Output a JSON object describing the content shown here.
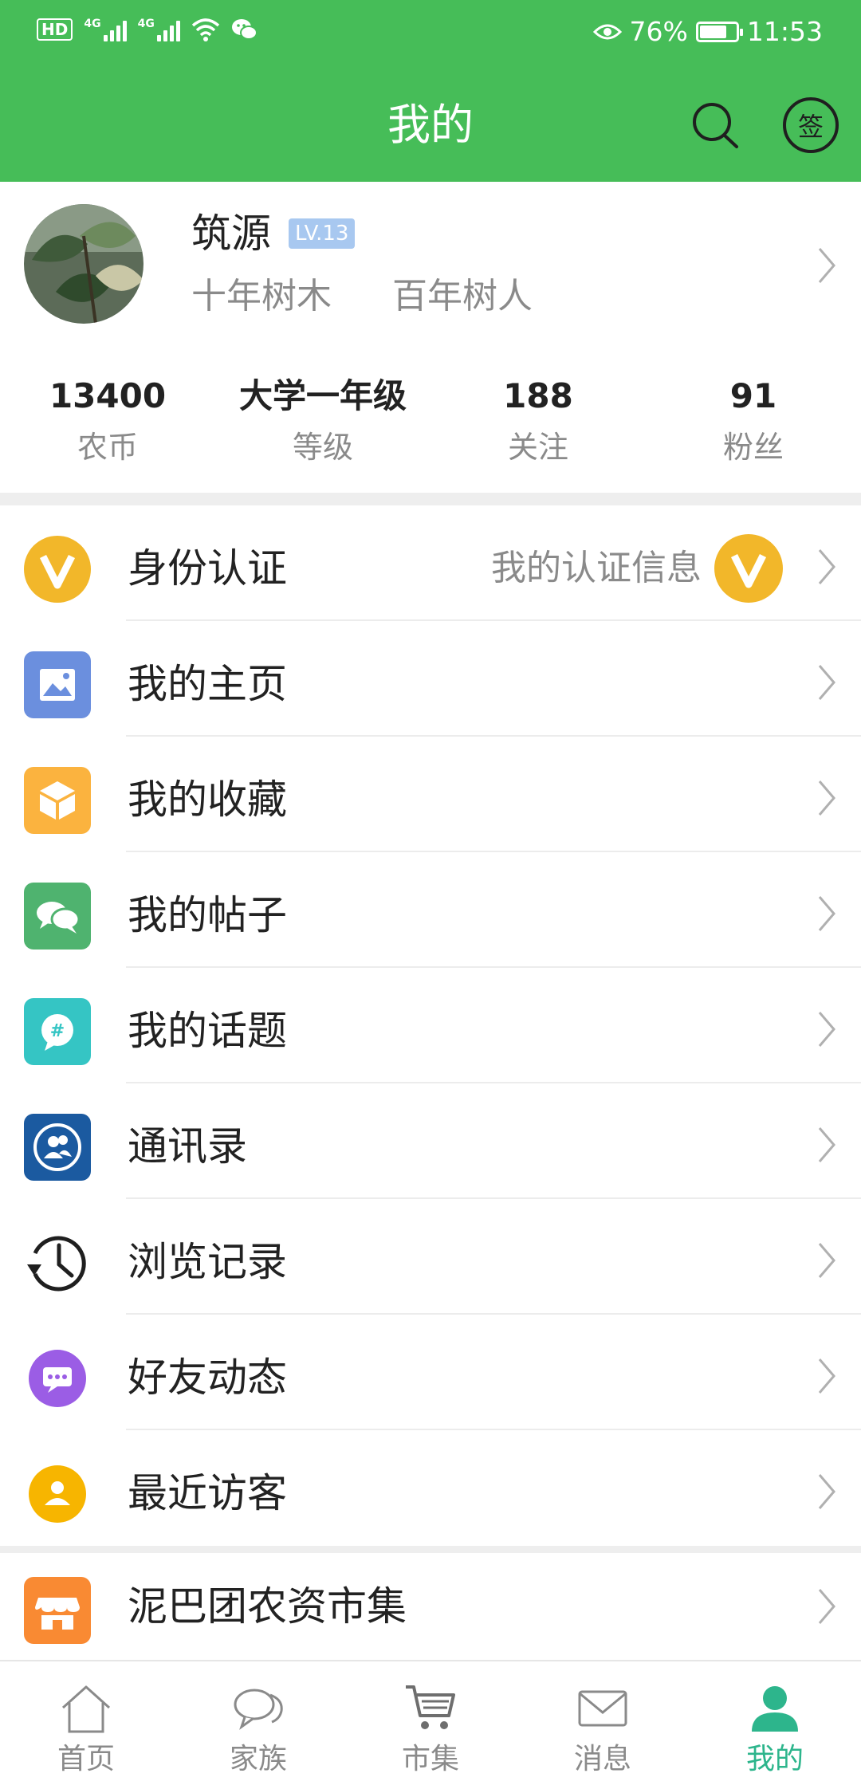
{
  "status_bar": {
    "network": [
      "4G",
      "4G"
    ],
    "battery": "76%",
    "battery_level": 0.76,
    "time": "11:53"
  },
  "header": {
    "title": "我的",
    "sign_label": "签",
    "accent_color": "#46bd58"
  },
  "profile": {
    "name": "筑源",
    "level_badge": "LV.13",
    "motto_1": "十年树木",
    "motto_2": "百年树人",
    "stats": [
      {
        "value": "13400",
        "label": "农币"
      },
      {
        "value": "大学一年级",
        "label": "等级"
      },
      {
        "value": "188",
        "label": "关注"
      },
      {
        "value": "91",
        "label": "粉丝"
      }
    ]
  },
  "menu": [
    {
      "label": "身份认证",
      "icon": "verified-v-icon",
      "color": "#f2b72a",
      "extra": "我的认证信息"
    },
    {
      "label": "我的主页",
      "icon": "picture-icon",
      "color": "#6b8fde"
    },
    {
      "label": "我的收藏",
      "icon": "box-icon",
      "color": "#fbb33f"
    },
    {
      "label": "我的帖子",
      "icon": "chat-bubbles-icon",
      "color": "#4fb36f"
    },
    {
      "label": "我的话题",
      "icon": "hashtag-bubble-icon",
      "color": "#35c5c4"
    },
    {
      "label": "通讯录",
      "icon": "contacts-icon",
      "color": "#1b5aa0"
    },
    {
      "label": "浏览记录",
      "icon": "history-clock-icon",
      "color": "#1f1f1f"
    },
    {
      "label": "好友动态",
      "icon": "message-dots-icon",
      "color": "#9b5de5"
    },
    {
      "label": "最近访客",
      "icon": "visitor-person-icon",
      "color": "#f7b500"
    }
  ],
  "market": {
    "label": "泥巴团农资市集",
    "icon": "store-icon",
    "color": "#f98a33"
  },
  "tabs": [
    {
      "label": "首页",
      "icon": "home-icon"
    },
    {
      "label": "家族",
      "icon": "chat-icon"
    },
    {
      "label": "市集",
      "icon": "cart-icon"
    },
    {
      "label": "消息",
      "icon": "mail-icon"
    },
    {
      "label": "我的",
      "icon": "person-icon",
      "active": true
    }
  ]
}
